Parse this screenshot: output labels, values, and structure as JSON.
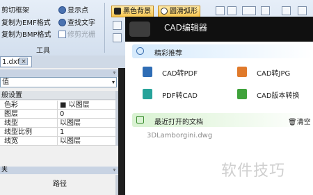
{
  "ribbon": {
    "left_buttons": [
      "剪切框架",
      "复制为EMF格式",
      "复制为BMP格式"
    ],
    "mid_buttons": [
      "显示点",
      "查找文字",
      "修剪光栅"
    ],
    "group_label": "工具",
    "toggle_buttons": [
      "黑色背景",
      "圆滑弧形"
    ]
  },
  "tab": {
    "label": "1.dxf",
    "close": "×"
  },
  "properties": {
    "title_pin": "ᵠ",
    "combo_value": "值",
    "combo_arrow": "▾",
    "section": "般设置",
    "rows": [
      {
        "name": "色彩",
        "value": "■ 以图层"
      },
      {
        "name": "图层",
        "value": "0"
      },
      {
        "name": "线型",
        "value": "以图层"
      },
      {
        "name": "线型比例",
        "value": "1"
      },
      {
        "name": "线宽",
        "value": "以图层"
      }
    ],
    "folder_title": "夹",
    "folder_col": "路径"
  },
  "cad_window": {
    "title": "CAD编辑器",
    "featured_header": "精彩推荐",
    "features": [
      "CAD转PDF",
      "CAD转JPG",
      "PDF转CAD",
      "CAD版本转换"
    ],
    "recent_header": "最近打开的文档",
    "clear_label": "清空",
    "recent_files": [
      "3DLamborgini.dwg"
    ]
  },
  "watermark": "软件技巧"
}
